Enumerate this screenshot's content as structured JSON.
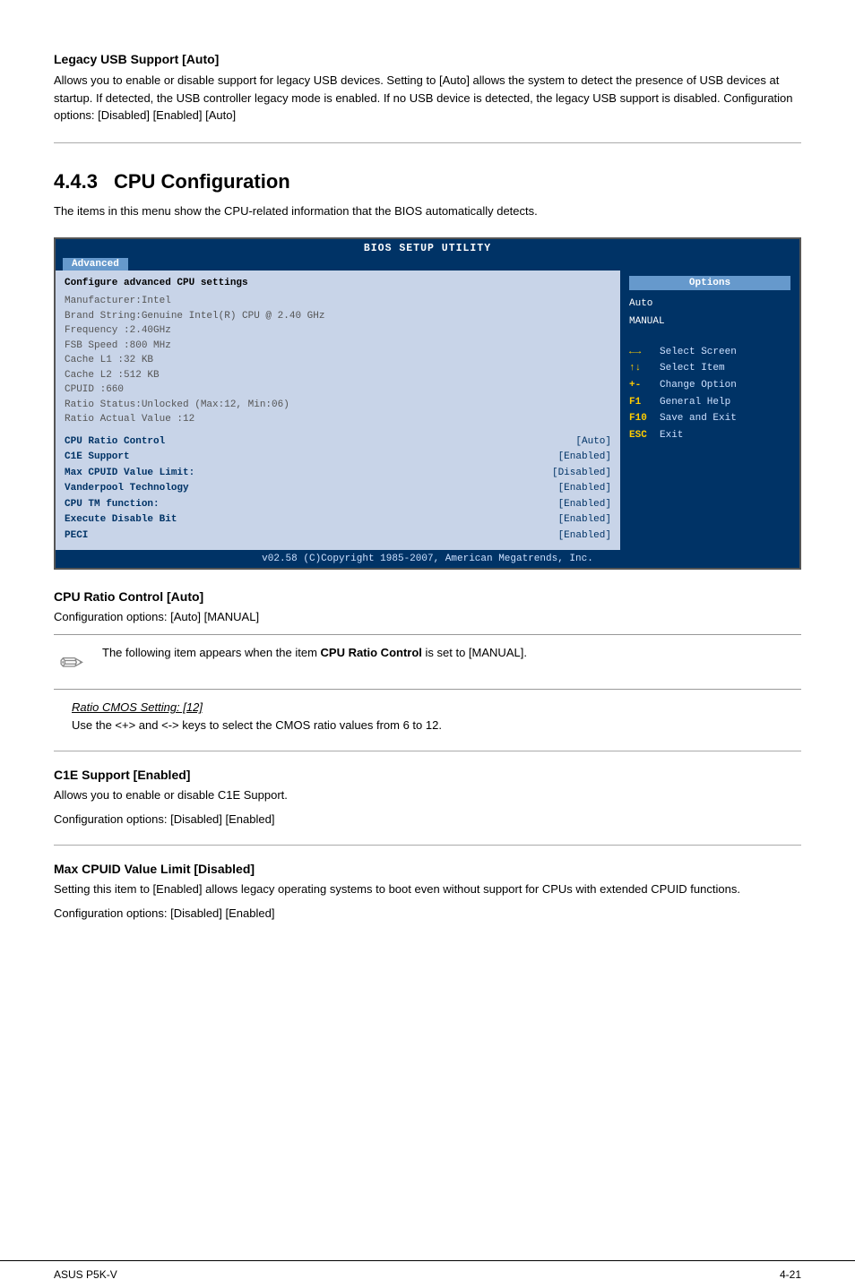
{
  "legacy_usb": {
    "title": "Legacy USB Support [Auto]",
    "text": "Allows you to enable or disable support for legacy USB devices. Setting to [Auto] allows the system to detect the presence of USB devices at startup. If detected, the USB controller legacy mode is enabled. If no USB device is detected, the legacy USB support is disabled. Configuration options: [Disabled] [Enabled] [Auto]"
  },
  "chapter": {
    "number": "4.4.3",
    "title": "CPU Configuration"
  },
  "chapter_intro": "The items in this menu show the CPU-related information that the BIOS automatically detects.",
  "bios": {
    "title": "BIOS SETUP UTILITY",
    "tab": "Advanced",
    "left_header": "Configure advanced CPU settings",
    "info_lines": [
      "Manufacturer:Intel",
      "Brand String:Genuine Intel(R) CPU @ 2.40 GHz",
      "Frequency   :2.40GHz",
      "FSB Speed   :800 MHz",
      "Cache L1    :32 KB",
      "Cache L2    :512 KB",
      "CPUID       :660",
      "Ratio Status:Unlocked (Max:12, Min:06)",
      "Ratio Actual Value  :12"
    ],
    "items": [
      {
        "name": "CPU Ratio Control",
        "value": "[Auto]"
      },
      {
        "name": "C1E Support",
        "value": "[Enabled]"
      },
      {
        "name": "Max CPUID Value Limit:",
        "value": "[Disabled]"
      },
      {
        "name": "Vanderpool Technology",
        "value": "[Enabled]"
      },
      {
        "name": "CPU TM function:",
        "value": "[Enabled]"
      },
      {
        "name": "Execute Disable Bit",
        "value": "[Enabled]"
      },
      {
        "name": "PECI",
        "value": "[Enabled]"
      }
    ],
    "options_header": "Options",
    "options": [
      "Auto",
      "MANUAL"
    ],
    "nav": [
      {
        "key": "←→",
        "desc": "Select Screen"
      },
      {
        "key": "↑↓",
        "desc": "Select Item"
      },
      {
        "key": "+-",
        "desc": "Change Option"
      },
      {
        "key": "F1",
        "desc": "General Help"
      },
      {
        "key": "F10",
        "desc": "Save and Exit"
      },
      {
        "key": "ESC",
        "desc": "Exit"
      }
    ],
    "footer": "v02.58 (C)Copyright 1985-2007, American Megatrends, Inc."
  },
  "cpu_ratio": {
    "title": "CPU Ratio Control [Auto]",
    "text": "Configuration options: [Auto] [MANUAL]",
    "note": "The following item appears when the item CPU Ratio Control is set to [MANUAL].",
    "ratio_cmos_link": "Ratio CMOS Setting: [12]",
    "ratio_cmos_desc": "Use the <+> and <-> keys to select the CMOS ratio values from 6 to 12."
  },
  "c1e": {
    "title": "C1E Support [Enabled]",
    "text1": "Allows you to enable or disable C1E Support.",
    "text2": "Configuration options: [Disabled] [Enabled]"
  },
  "max_cpuid": {
    "title": "Max CPUID Value Limit [Disabled]",
    "text1": "Setting this item to [Enabled] allows legacy operating systems to boot even without support for CPUs with extended CPUID functions.",
    "text2": "Configuration options: [Disabled] [Enabled]"
  },
  "footer": {
    "brand": "ASUS P5K-V",
    "page": "4-21"
  }
}
